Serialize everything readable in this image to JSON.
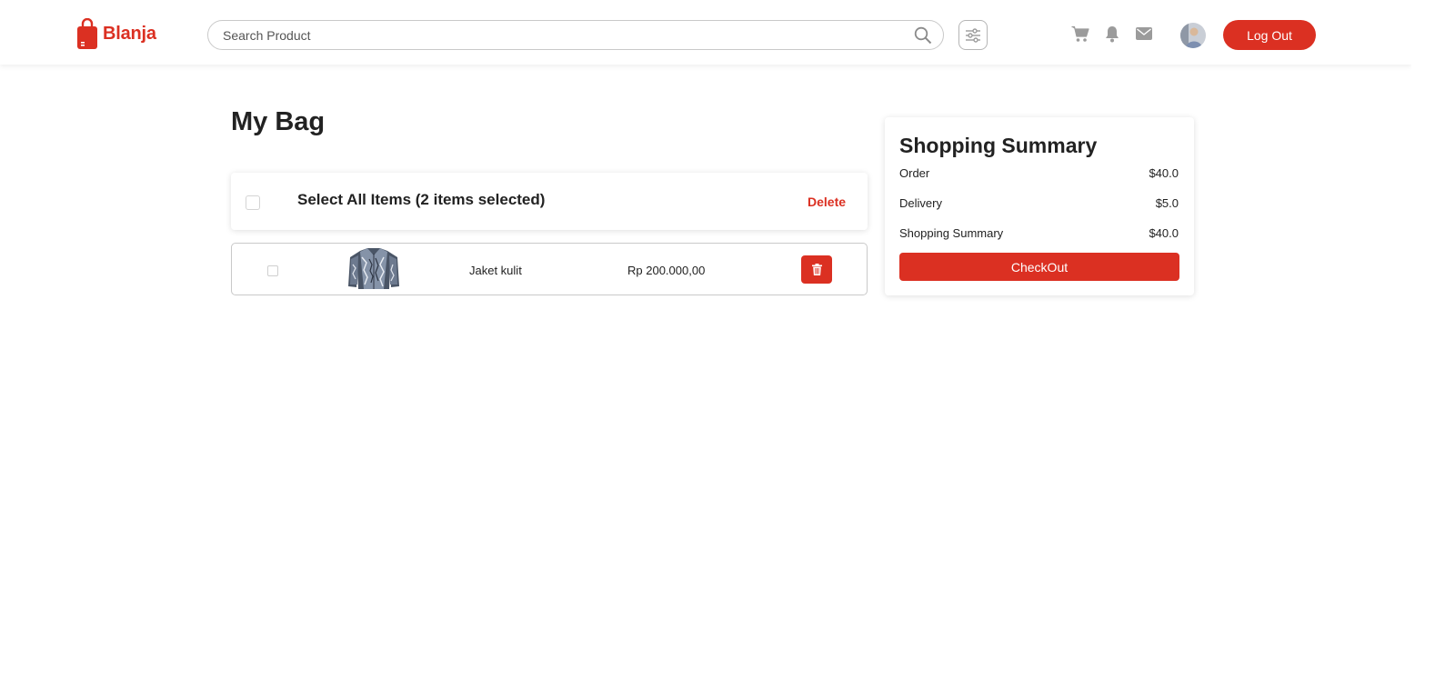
{
  "navbar": {
    "brand": "Blanja",
    "search": {
      "placeholder": "Search Product",
      "value": ""
    },
    "logout_label": "Log Out",
    "icons": [
      "search-icon",
      "filter-icon",
      "cart-icon",
      "bell-icon",
      "mail-icon"
    ]
  },
  "colors": {
    "accent": "#DB3022",
    "text": "#222222",
    "icon": "#9b9b9b"
  },
  "bag": {
    "title": "My Bag",
    "select_all_label": "Select All Items (2 items selected)",
    "delete_label": "Delete",
    "items": [
      {
        "name": "Jaket kulit",
        "price": "Rp 200.000,00",
        "checked": false
      }
    ]
  },
  "summary": {
    "title": "Shopping Summary",
    "rows": [
      {
        "label": "Order",
        "value": "$40.0"
      },
      {
        "label": "Delivery",
        "value": "$5.0"
      },
      {
        "label": "Shopping Summary",
        "value": "$40.0"
      }
    ],
    "checkout_label": "CheckOut"
  }
}
